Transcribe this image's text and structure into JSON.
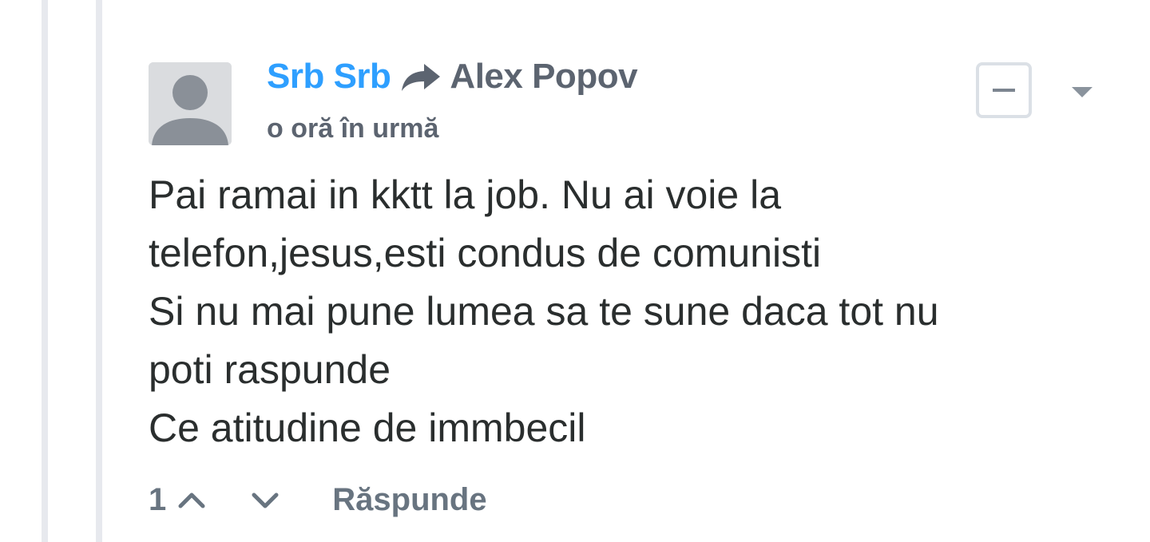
{
  "comment": {
    "author": "Srb Srb",
    "reply_to": "Alex Popov",
    "timestamp": "o oră în urmă",
    "body_lines": [
      "Pai ramai in kktt la job. Nu ai voie la",
      "telefon,jesus,esti condus de comunisti",
      "Si nu mai pune lumea sa te sune daca tot nu",
      "poti raspunde",
      "Ce atitudine de immbecil"
    ],
    "votes": "1",
    "reply_label": "Răspunde"
  },
  "icons": {
    "avatar": "default-user-avatar",
    "reply_arrow": "share-arrow-icon",
    "collapse": "minus-icon",
    "menu": "caret-down-icon",
    "upvote": "chevron-up-icon",
    "downvote": "chevron-down-icon"
  },
  "colors": {
    "author": "#2e9fff",
    "meta": "#5c6470",
    "body_text": "#2a2e2e",
    "thread_line": "#e7e9ee"
  }
}
